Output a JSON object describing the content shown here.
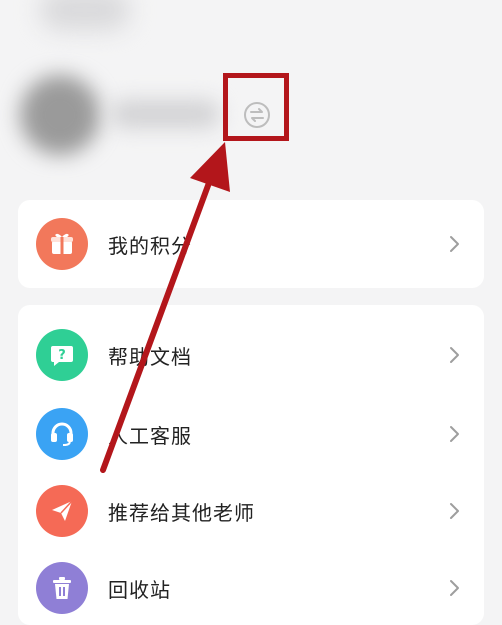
{
  "header": {
    "switch_icon": "switch-arrows-icon"
  },
  "menu_groups": [
    {
      "items": [
        {
          "label": "我的积分",
          "icon": "gift-box-icon",
          "color": "#f2785b"
        }
      ]
    },
    {
      "items": [
        {
          "label": "帮助文档",
          "icon": "help-chat-icon",
          "color": "#2fcf95"
        },
        {
          "label": "人工客服",
          "icon": "headset-icon",
          "color": "#3aa3f4"
        },
        {
          "label": "推荐给其他老师",
          "icon": "send-plane-icon",
          "color": "#f56a56"
        },
        {
          "label": "回收站",
          "icon": "trash-icon",
          "color": "#8f7fd6"
        }
      ]
    }
  ],
  "annotation": {
    "box_color": "#b3161b",
    "arrow_color": "#b3161b"
  }
}
